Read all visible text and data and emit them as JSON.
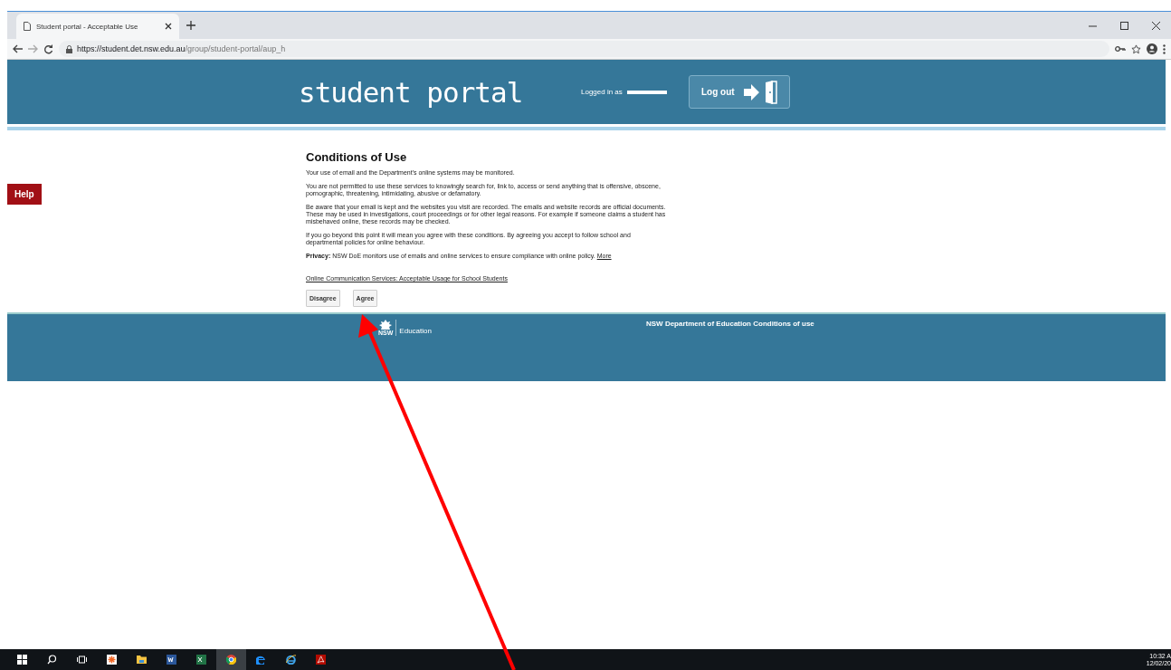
{
  "browser": {
    "tab_title": "Student portal - Acceptable Use",
    "url_host": "https://student.det.nsw.edu.au",
    "url_path": "/group/student-portal/aup_h"
  },
  "header": {
    "logo": "student portal",
    "logged_in_label": "Logged in as",
    "logout_button": "Log out"
  },
  "help_button": "Help",
  "content": {
    "title": "Conditions of Use",
    "paragraphs": [
      {
        "text": "Your use of email and the Department's online systems may be monitored."
      },
      {
        "text": "You are not permitted to use these services to knowingly search for, link to, access or send anything that is offensive, obscene, pornographic, threatening, intimidating, abusive or defamatory."
      },
      {
        "text": "Be aware that your email is kept and the websites you visit are recorded. The emails and website records are official documents. These may be used in investigations, court proceedings or for other legal reasons. For example if someone claims a student has misbehaved online, these records may be checked."
      },
      {
        "text": "If you go beyond this point it will mean you agree with these conditions. By agreeing you accept to follow school and departmental policies for online behaviour."
      },
      {
        "text": "**Privacy:** NSW DoE monitors use of emails and online services to ensure compliance with online policy.",
        "link": "More"
      }
    ],
    "policy_link": "Online Communication Services: Acceptable Usage for School Students",
    "buttons": [
      "Disagree",
      "Agree"
    ]
  },
  "footer": {
    "logo_text": "NSW",
    "department": "Education",
    "conditions_link": "NSW Department of Education Conditions of use"
  },
  "taskbar": {
    "time": "10:32 A",
    "date": "12/02/20"
  }
}
